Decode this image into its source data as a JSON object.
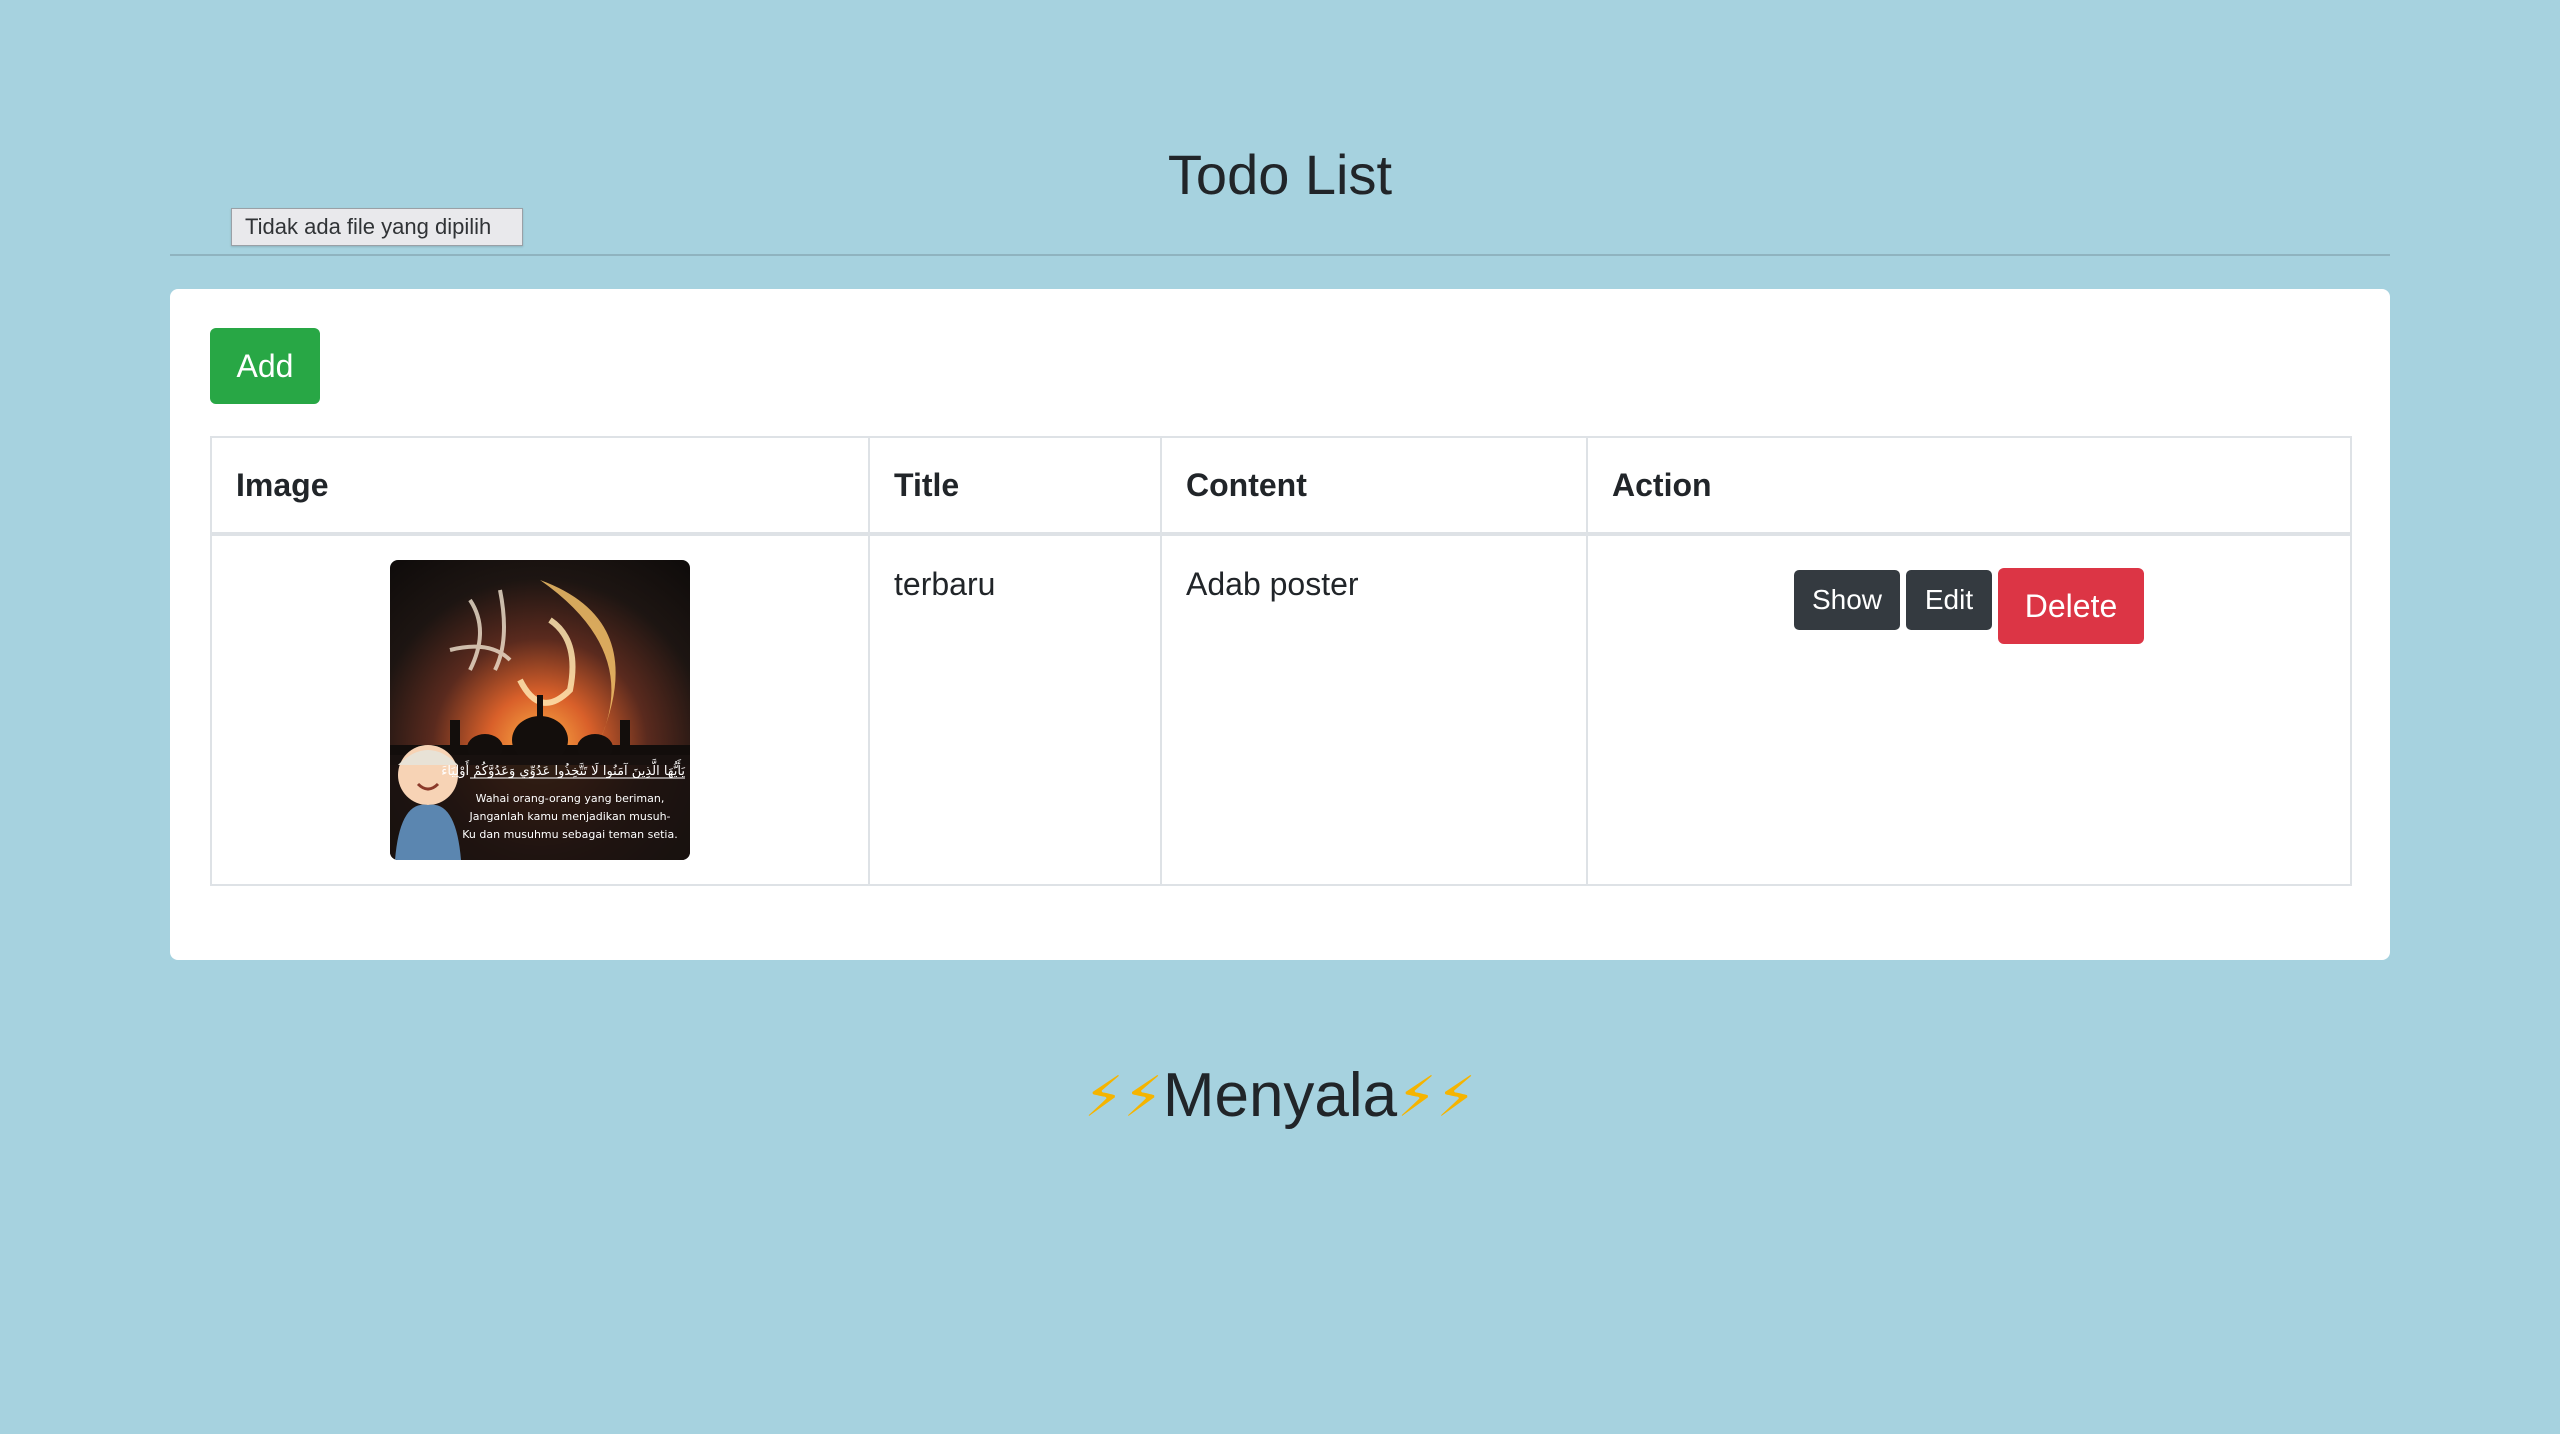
{
  "header": {
    "title": "Todo List"
  },
  "file_input": {
    "tooltip": "Tidak ada file yang dipilih"
  },
  "toolbar": {
    "add_label": "Add"
  },
  "table": {
    "columns": [
      "Image",
      "Title",
      "Content",
      "Action"
    ],
    "rows": [
      {
        "image_icon": "poster-thumbnail",
        "image_text": [
          "يَأَيُّهَا الَّذِينَ آمَنُوا لَا تَتَّخِذُوا عَدُوِّي وَعَدُوَّكُمْ أَوْلِيَاءَ",
          "Wahai orang-orang yang beriman,",
          "Janganlah kamu menjadikan musuh-",
          "Ku dan musuhmu sebagai teman setia."
        ],
        "title": "terbaru",
        "content": "Adab poster",
        "actions": {
          "show": "Show",
          "edit": "Edit",
          "delete": "Delete"
        }
      }
    ]
  },
  "footer": {
    "text": "Menyala",
    "left_icons": "⚡⚡",
    "right_icons": "⚡⚡",
    "icon_name": "lightning-icon"
  },
  "colors": {
    "background": "#a6d2df",
    "add_button": "#28a745",
    "dark_button": "#343a40",
    "delete_button": "#dc3545"
  }
}
